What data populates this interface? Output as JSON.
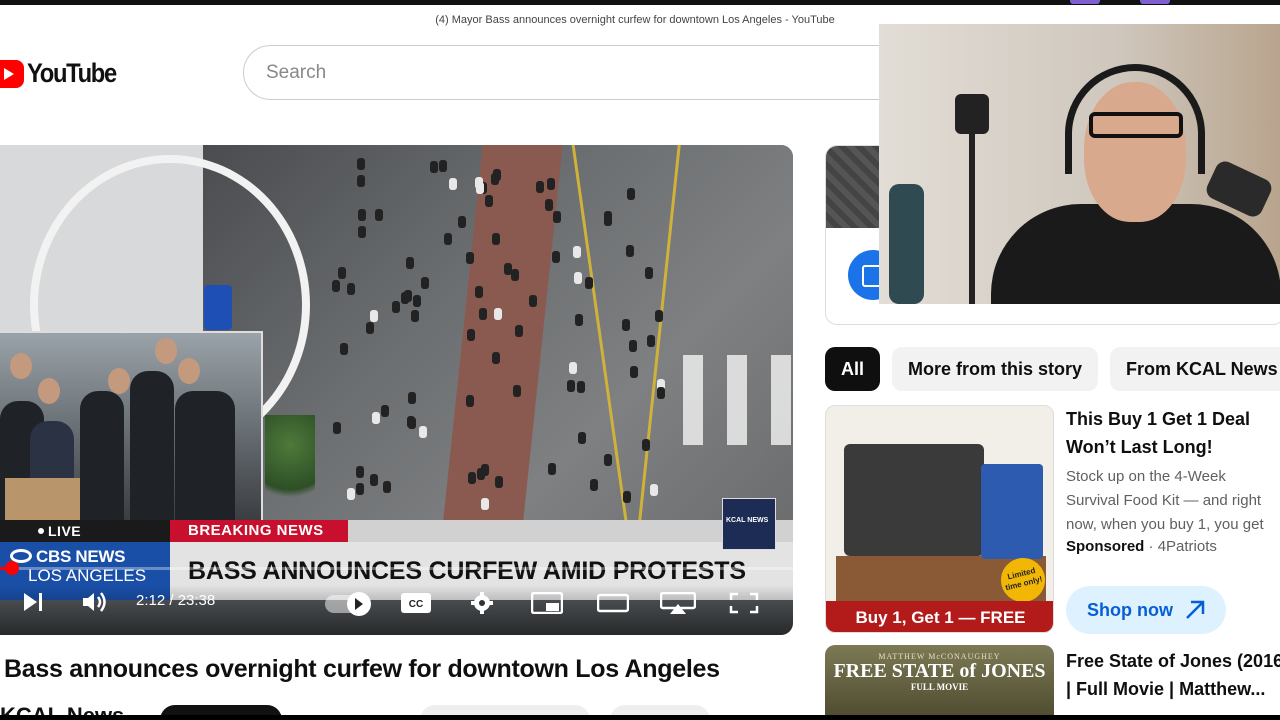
{
  "window": {
    "title": "(4) Mayor Bass announces overnight curfew for downtown Los Angeles - YouTube"
  },
  "header": {
    "logo_text": "YouTube",
    "search_placeholder": "Search"
  },
  "video": {
    "live_label": "LIVE",
    "breaking_label": "BREAKING NEWS",
    "network_name": "CBS NEWS",
    "network_sub": "LOS ANGELES",
    "headline": "BASS ANNOUNCES CURFEW AMID PROTESTS",
    "station_logo": "KCAL NEWS",
    "time_display": "2:12 / 23:38",
    "progress_fraction": 0.015,
    "title": "Bass announces overnight curfew for downtown Los Angeles",
    "channel": "KCAL News"
  },
  "chips": [
    "All",
    "More from this story",
    "From KCAL News"
  ],
  "ad": {
    "thumb_banner": "Buy 1, Get 1 — FREE",
    "thumb_seal": "Limited time only!",
    "title": "This Buy 1 Get 1 Deal Won’t Last Long!",
    "description": "Stock up on the 4-Week Survival Food Kit — and right now, when you buy 1, you get",
    "sponsored": "Sponsored",
    "advertiser": "4Patriots",
    "cta": "Shop now"
  },
  "recommendation": {
    "thumb_top": "MATTHEW McCONAUGHEY",
    "thumb_title": "FREE STATE of JONES",
    "thumb_sub": "FULL MOVIE",
    "title_line1": "Free State of Jones (2016",
    "title_line2": "| Full Movie | Matthew..."
  },
  "colors": {
    "youtube_red": "#ff0000",
    "breaking_red": "#c8102e",
    "cbs_blue": "#1a4fa8",
    "cta_blue": "#065fd4"
  }
}
